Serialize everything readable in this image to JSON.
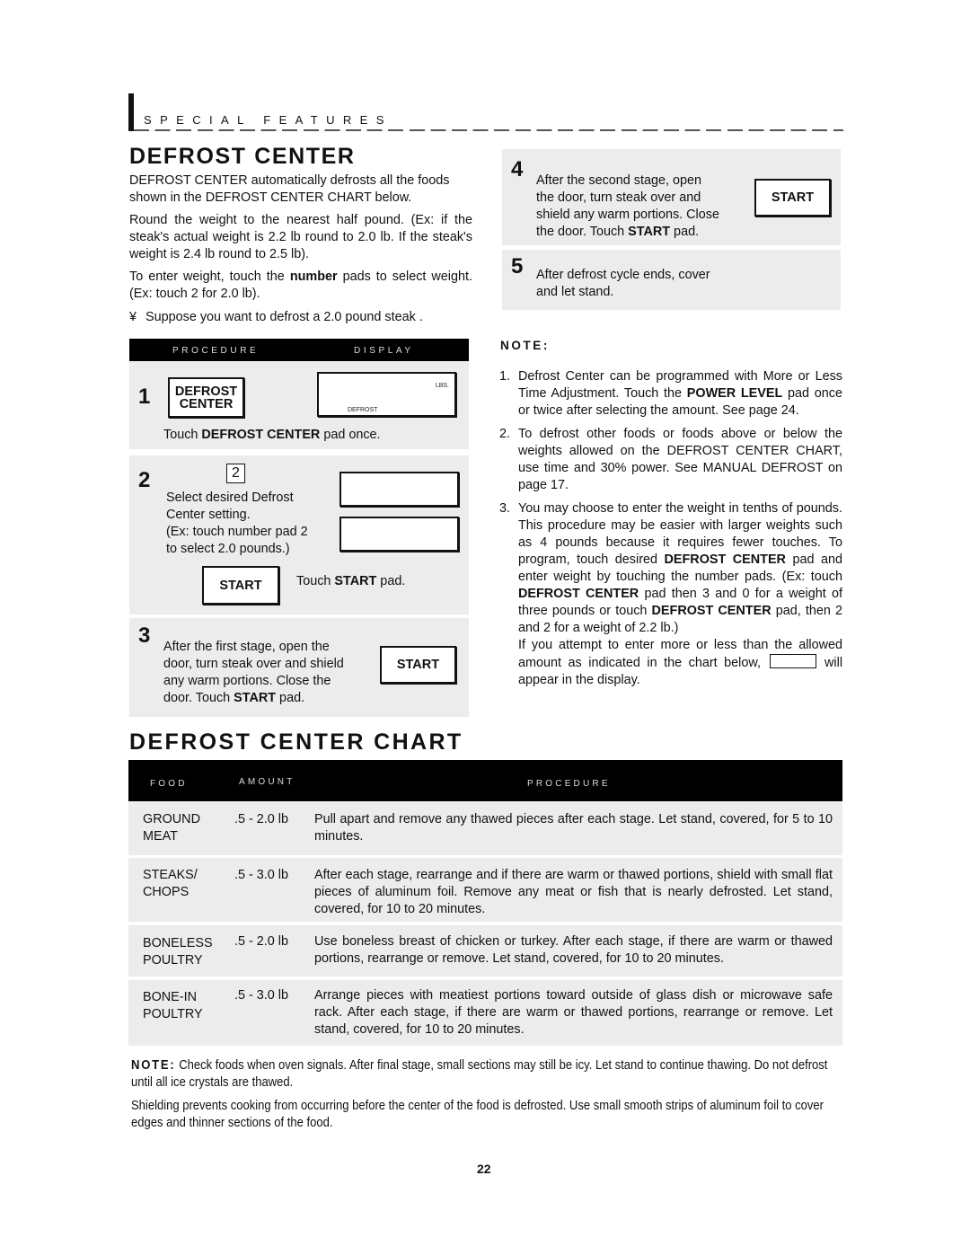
{
  "section": {
    "label": "SPECIAL FEATURES"
  },
  "defrost_center": {
    "title": "DEFROST CENTER",
    "intro": "DEFROST CENTER automatically defrosts all the foods shown in the DEFROST CENTER CHART below.",
    "rounding": "Round the weight to the nearest half pound. (Ex: if the steak's actual weight is 2.2 lb round to 2.0 lb. If the steak's weight is 2.4 lb round to 2.5 lb).",
    "enter_weight_pre": "To enter weight, touch the ",
    "enter_weight_bold": "number",
    "enter_weight_post": " pads to select weight. (Ex: touch 2   for 2.0 lb).",
    "bullet_glyph": "¥",
    "suppose": "Suppose you want to defrost a 2.0 pound steak ."
  },
  "procedure_table": {
    "col_procedure": "PROCEDURE",
    "col_display": "DISPLAY",
    "steps": [
      {
        "number": "1",
        "pad_line1": "DEFROST",
        "pad_line2": "CENTER",
        "display_lbs": "LBS.",
        "display_mode": "DEFROST",
        "instruction_pre": "Touch ",
        "instruction_bold": "DEFROST CENTER",
        "instruction_post": " pad once."
      },
      {
        "number": "2",
        "key": "2",
        "text": "Select desired Defrost Center setting. (Ex: touch number pad 2 to select 2.0 pounds.)",
        "text_lines": [
          "Select desired Defrost",
          "Center setting.",
          "(Ex: touch number pad 2",
          "to select 2.0 pounds.)"
        ],
        "pad": "START",
        "instruction_pre": "Touch ",
        "instruction_bold": "START",
        "instruction_post": " pad."
      },
      {
        "number": "3",
        "text_lines": [
          "After the first stage, open the",
          "door, turn steak over and shield",
          "any warm portions. Close the"
        ],
        "last_pre": "door. Touch ",
        "last_bold": "START",
        "last_post": " pad.",
        "pad": "START"
      },
      {
        "number": "4",
        "text_lines": [
          "After the second stage, open",
          "the door, turn steak over and",
          "shield any warm portions. Close"
        ],
        "last_pre": "the door. Touch ",
        "last_bold": "START",
        "last_post": " pad.",
        "pad": "START"
      },
      {
        "number": "5",
        "text_lines": [
          "After defrost cycle ends, cover",
          "and let stand."
        ]
      }
    ]
  },
  "notes": {
    "label": "NOTE:",
    "items": [
      {
        "n": "1.",
        "a": "Defrost Center can be programmed with More or Less Time Adjustment. Touch the ",
        "b": "POWER LEVEL",
        "c": " pad once or twice after selecting the amount. See page 24."
      },
      {
        "n": "2.",
        "a": "To defrost other foods or foods above or below the weights allowed on the DEFROST CENTER CHART, use time and 30% power. See MANUAL DEFROST on page 17."
      },
      {
        "n": "3.",
        "a": "You may choose to enter the weight in tenths of pounds. This procedure may be easier with larger weights such as 4 pounds because it requires fewer touches. To program, touch desired ",
        "b": "DEFROST CENTER",
        "c": " pad and enter weight by touching the number pads. (Ex: touch ",
        "d": "DEFROST CENTER",
        "e": " pad then 3   and 0   for a weight of three pounds or touch ",
        "f": "DEFROST CENTER",
        "g": " pad, then 2   and 2   for a weight of 2.2 lb.)",
        "h": "If you attempt to enter more or less than the allowed amount as indicated in the chart below,",
        "i": "will appear in the display."
      }
    ]
  },
  "chart": {
    "title": "DEFROST CENTER CHART",
    "headers": {
      "food": "FOOD",
      "amount": "AMOUNT",
      "procedure": "PROCEDURE"
    },
    "rows": [
      {
        "food_lines": [
          "GROUND",
          "MEAT"
        ],
        "amount": ".5 - 2.0 lb",
        "procedure": "Pull apart and remove any thawed pieces after each stage. Let stand, covered, for 5 to 10 minutes."
      },
      {
        "food_lines": [
          "STEAKS/",
          "CHOPS"
        ],
        "amount": ".5 - 3.0 lb",
        "procedure": "After each stage, rearrange and if there are warm or thawed portions, shield   with small flat pieces of aluminum foil. Remove any meat or fish that is nearly defrosted. Let stand, covered, for 10 to 20 minutes."
      },
      {
        "food_lines": [
          "BONELESS",
          "POULTRY"
        ],
        "amount": ".5 - 2.0 lb",
        "procedure": "Use boneless breast of chicken or turkey. After each stage, if there are warm or thawed portions, rearrange or remove. Let stand, covered, for 10 to 20 minutes."
      },
      {
        "food_lines": [
          "BONE-IN",
          "POULTRY"
        ],
        "amount": ".5 - 3.0 lb",
        "procedure": "Arrange pieces with meatiest portions toward outside of glass dish or microwave safe rack. After each stage, if there are warm or thawed portions, rearrange or remove. Let stand, covered, for 10 to 20 minutes."
      }
    ]
  },
  "footer": {
    "note_label": "NOTE:",
    "note_text": " Check foods when oven signals. After final stage, small sections may still be icy. Let stand to continue thawing. Do not defrost until all ice crystals are thawed.",
    "shielding": "Shielding prevents cooking from occurring before the center of the food is defrosted. Use small smooth strips of aluminum foil to cover edges and thinner sections of the food.",
    "page_number": "22"
  }
}
